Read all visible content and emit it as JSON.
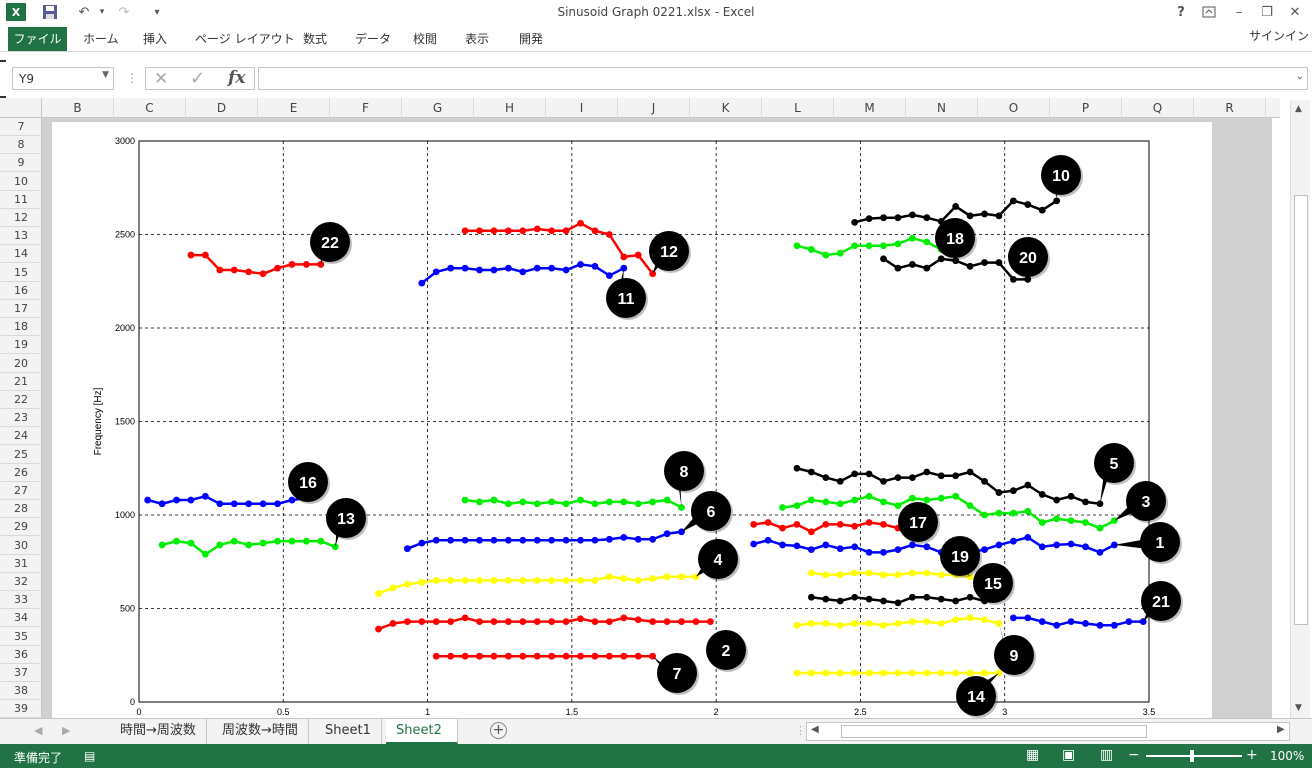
{
  "window": {
    "title": "Sinusoid Graph 0221.xlsx - Excel",
    "help": "?",
    "min": "–",
    "restore": "❐",
    "close": "✕"
  },
  "qat": {
    "undo": "↶",
    "redo": "↷",
    "more": "▾"
  },
  "ribbon": {
    "file": "ファイル",
    "tabs": [
      "ホーム",
      "挿入",
      "ページ レイアウト",
      "数式",
      "データ",
      "校閲",
      "表示",
      "開発"
    ],
    "signin": "サインイン"
  },
  "formula_bar": {
    "name_box": "Y9",
    "cancel": "✕",
    "enter": "✓",
    "fx": "fx",
    "value": ""
  },
  "columns": [
    "B",
    "C",
    "D",
    "E",
    "F",
    "G",
    "H",
    "I",
    "J",
    "K",
    "L",
    "M",
    "N",
    "O",
    "P",
    "Q",
    "R"
  ],
  "rows": [
    "7",
    "8",
    "9",
    "10",
    "11",
    "12",
    "13",
    "14",
    "15",
    "16",
    "17",
    "18",
    "19",
    "20",
    "21",
    "22",
    "23",
    "24",
    "25",
    "26",
    "27",
    "28",
    "29",
    "30",
    "31",
    "32",
    "33",
    "34",
    "35",
    "36",
    "37",
    "38",
    "39"
  ],
  "sheets": [
    "時間→周波数",
    "周波数→時間",
    "Sheet1",
    "Sheet2"
  ],
  "active_sheet": "Sheet2",
  "status": {
    "ready": "準備完了",
    "zoom": "100%"
  },
  "chart_data": {
    "type": "line",
    "ylabel": "Frequency [Hz]",
    "xlim": [
      0,
      3.5
    ],
    "ylim": [
      0,
      3000
    ],
    "xticks": [
      "0",
      "0.5",
      "1",
      "1.5",
      "2",
      "2.5",
      "3",
      "3.5"
    ],
    "yticks": [
      "0",
      "500",
      "1000",
      "1500",
      "2000",
      "2500",
      "3000"
    ],
    "grid": true,
    "series": [
      {
        "name": "1",
        "color": "#0000ff",
        "x": [
          2.13,
          2.18,
          2.23,
          2.28,
          2.33,
          2.38,
          2.43,
          2.48,
          2.53,
          2.58,
          2.63,
          2.68,
          2.73,
          2.78,
          2.83,
          2.88,
          2.93,
          2.98,
          3.03,
          3.08,
          3.13,
          3.18,
          3.23,
          3.28,
          3.33,
          3.38
        ],
        "y": [
          845,
          865,
          840,
          835,
          815,
          840,
          820,
          830,
          800,
          800,
          815,
          840,
          830,
          800,
          825,
          800,
          815,
          840,
          860,
          880,
          830,
          840,
          845,
          830,
          800,
          840
        ]
      },
      {
        "name": "2",
        "color": "#ff0000",
        "x": [
          0.83,
          0.88,
          0.93,
          0.98,
          1.03,
          1.08,
          1.13,
          1.18,
          1.23,
          1.28,
          1.33,
          1.38,
          1.43,
          1.48,
          1.53,
          1.58,
          1.63,
          1.68,
          1.73,
          1.78,
          1.83,
          1.88,
          1.93,
          1.98
        ],
        "y": [
          390,
          420,
          430,
          430,
          430,
          430,
          450,
          430,
          430,
          430,
          430,
          430,
          430,
          430,
          445,
          430,
          430,
          450,
          440,
          430,
          430,
          430,
          430,
          430
        ]
      },
      {
        "name": "3",
        "color": "#00ee00",
        "x": [
          2.23,
          2.28,
          2.33,
          2.38,
          2.43,
          2.48,
          2.53,
          2.58,
          2.63,
          2.68,
          2.73,
          2.78,
          2.83,
          2.88,
          2.93,
          2.98,
          3.03,
          3.08,
          3.13,
          3.18,
          3.23,
          3.28,
          3.33,
          3.38
        ],
        "y": [
          1040,
          1050,
          1080,
          1070,
          1060,
          1080,
          1100,
          1070,
          1050,
          1090,
          1080,
          1090,
          1100,
          1050,
          1000,
          1010,
          1010,
          1020,
          960,
          980,
          970,
          960,
          930,
          970
        ]
      },
      {
        "name": "4",
        "color": "#ffff00",
        "x": [
          0.83,
          0.88,
          0.93,
          0.98,
          1.03,
          1.08,
          1.13,
          1.18,
          1.23,
          1.28,
          1.33,
          1.38,
          1.43,
          1.48,
          1.53,
          1.58,
          1.63,
          1.68,
          1.73,
          1.78,
          1.83,
          1.88,
          1.93
        ],
        "y": [
          580,
          610,
          630,
          640,
          650,
          650,
          650,
          650,
          650,
          650,
          650,
          650,
          650,
          650,
          650,
          650,
          670,
          660,
          650,
          660,
          670,
          670,
          670
        ]
      },
      {
        "name": "5",
        "color": "#000000",
        "x": [
          2.28,
          2.33,
          2.38,
          2.43,
          2.48,
          2.53,
          2.58,
          2.63,
          2.68,
          2.73,
          2.78,
          2.83,
          2.88,
          2.93,
          2.98,
          3.03,
          3.08,
          3.13,
          3.18,
          3.23,
          3.28,
          3.33
        ],
        "y": [
          1250,
          1230,
          1200,
          1180,
          1220,
          1220,
          1180,
          1200,
          1200,
          1230,
          1210,
          1210,
          1230,
          1180,
          1120,
          1130,
          1160,
          1110,
          1080,
          1100,
          1070,
          1060
        ]
      },
      {
        "name": "6",
        "color": "#0000ff",
        "x": [
          0.93,
          0.98,
          1.03,
          1.08,
          1.13,
          1.18,
          1.23,
          1.28,
          1.33,
          1.38,
          1.43,
          1.48,
          1.53,
          1.58,
          1.63,
          1.68,
          1.73,
          1.78,
          1.83,
          1.88
        ],
        "y": [
          820,
          850,
          865,
          865,
          865,
          865,
          865,
          865,
          865,
          865,
          865,
          865,
          865,
          865,
          870,
          880,
          870,
          870,
          900,
          910
        ]
      },
      {
        "name": "7",
        "color": "#ff0000",
        "x": [
          1.03,
          1.08,
          1.13,
          1.18,
          1.23,
          1.28,
          1.33,
          1.38,
          1.43,
          1.48,
          1.53,
          1.58,
          1.63,
          1.68,
          1.73,
          1.78
        ],
        "y": [
          245,
          245,
          245,
          245,
          245,
          245,
          245,
          245,
          245,
          245,
          245,
          245,
          245,
          245,
          245,
          245
        ]
      },
      {
        "name": "8",
        "color": "#00ee00",
        "x": [
          1.13,
          1.18,
          1.23,
          1.28,
          1.33,
          1.38,
          1.43,
          1.48,
          1.53,
          1.58,
          1.63,
          1.68,
          1.73,
          1.78,
          1.83,
          1.88
        ],
        "y": [
          1080,
          1070,
          1080,
          1060,
          1070,
          1060,
          1070,
          1060,
          1080,
          1060,
          1070,
          1070,
          1060,
          1070,
          1080,
          1040
        ]
      },
      {
        "name": "9",
        "color": "#ffff00",
        "x": [
          2.28,
          2.33,
          2.38,
          2.43,
          2.48,
          2.53,
          2.58,
          2.63,
          2.68,
          2.73,
          2.78,
          2.83,
          2.88,
          2.93,
          2.98
        ],
        "y": [
          410,
          420,
          420,
          410,
          420,
          420,
          410,
          420,
          430,
          430,
          420,
          440,
          450,
          440,
          420
        ]
      },
      {
        "name": "10",
        "color": "#000000",
        "x": [
          2.48,
          2.53,
          2.58,
          2.63,
          2.68,
          2.73,
          2.78,
          2.83,
          2.88,
          2.93,
          2.98,
          3.03,
          3.08,
          3.13,
          3.18
        ],
        "y": [
          2565,
          2585,
          2590,
          2590,
          2605,
          2590,
          2570,
          2650,
          2600,
          2610,
          2600,
          2680,
          2660,
          2630,
          2680
        ]
      },
      {
        "name": "11",
        "color": "#0000ff",
        "x": [
          0.98,
          1.03,
          1.08,
          1.13,
          1.18,
          1.23,
          1.28,
          1.33,
          1.38,
          1.43,
          1.48,
          1.53,
          1.58,
          1.63,
          1.68
        ],
        "y": [
          2240,
          2300,
          2320,
          2320,
          2310,
          2310,
          2320,
          2300,
          2320,
          2320,
          2310,
          2340,
          2330,
          2280,
          2320
        ]
      },
      {
        "name": "12",
        "color": "#ff0000",
        "x": [
          1.13,
          1.18,
          1.23,
          1.28,
          1.33,
          1.38,
          1.43,
          1.48,
          1.53,
          1.58,
          1.63,
          1.68,
          1.73,
          1.78
        ],
        "y": [
          2520,
          2520,
          2520,
          2520,
          2520,
          2530,
          2520,
          2520,
          2560,
          2520,
          2500,
          2380,
          2390,
          2290
        ]
      },
      {
        "name": "13",
        "color": "#00ee00",
        "x": [
          0.08,
          0.13,
          0.18,
          0.23,
          0.28,
          0.33,
          0.38,
          0.43,
          0.48,
          0.53,
          0.58,
          0.63,
          0.68
        ],
        "y": [
          840,
          860,
          850,
          790,
          840,
          860,
          840,
          850,
          860,
          860,
          860,
          860,
          830
        ]
      },
      {
        "name": "14",
        "color": "#ffff00",
        "x": [
          2.28,
          2.33,
          2.38,
          2.43,
          2.48,
          2.53,
          2.58,
          2.63,
          2.68,
          2.73,
          2.78,
          2.83,
          2.88,
          2.93,
          2.98
        ],
        "y": [
          155,
          155,
          155,
          155,
          155,
          155,
          155,
          155,
          155,
          155,
          155,
          155,
          155,
          155,
          155
        ]
      },
      {
        "name": "15",
        "color": "#000000",
        "x": [
          2.33,
          2.38,
          2.43,
          2.48,
          2.53,
          2.58,
          2.63,
          2.68,
          2.73,
          2.78,
          2.83,
          2.88,
          2.93
        ],
        "y": [
          560,
          550,
          540,
          560,
          550,
          540,
          530,
          560,
          560,
          550,
          540,
          560,
          540
        ]
      },
      {
        "name": "16",
        "color": "#0000ff",
        "x": [
          0.03,
          0.08,
          0.13,
          0.18,
          0.23,
          0.28,
          0.33,
          0.38,
          0.43,
          0.48,
          0.53,
          0.58
        ],
        "y": [
          1080,
          1060,
          1080,
          1080,
          1100,
          1060,
          1060,
          1060,
          1060,
          1060,
          1080,
          1090
        ]
      },
      {
        "name": "17",
        "color": "#ff0000",
        "x": [
          2.13,
          2.18,
          2.23,
          2.28,
          2.33,
          2.38,
          2.43,
          2.48,
          2.53,
          2.58,
          2.63
        ],
        "y": [
          950,
          960,
          930,
          950,
          910,
          950,
          950,
          940,
          960,
          950,
          930
        ]
      },
      {
        "name": "18",
        "color": "#00ee00",
        "x": [
          2.28,
          2.33,
          2.38,
          2.43,
          2.48,
          2.53,
          2.58,
          2.63,
          2.68,
          2.73,
          2.78
        ],
        "y": [
          2440,
          2420,
          2390,
          2400,
          2440,
          2440,
          2440,
          2450,
          2480,
          2460,
          2420
        ]
      },
      {
        "name": "19",
        "color": "#ffff00",
        "x": [
          2.33,
          2.38,
          2.43,
          2.48,
          2.53,
          2.58,
          2.63,
          2.68,
          2.73,
          2.78,
          2.83,
          2.88
        ],
        "y": [
          690,
          680,
          680,
          690,
          690,
          680,
          680,
          690,
          690,
          680,
          680,
          670
        ]
      },
      {
        "name": "20",
        "color": "#000000",
        "x": [
          2.58,
          2.63,
          2.68,
          2.73,
          2.78,
          2.83,
          2.88,
          2.93,
          2.98,
          3.03,
          3.08
        ],
        "y": [
          2370,
          2320,
          2340,
          2320,
          2370,
          2360,
          2330,
          2350,
          2350,
          2260,
          2260
        ]
      },
      {
        "name": "21",
        "color": "#0000ff",
        "x": [
          3.03,
          3.08,
          3.13,
          3.18,
          3.23,
          3.28,
          3.33,
          3.38,
          3.43,
          3.48
        ],
        "y": [
          450,
          450,
          430,
          410,
          430,
          420,
          410,
          410,
          430,
          430
        ]
      },
      {
        "name": "22",
        "color": "#ff0000",
        "x": [
          0.18,
          0.23,
          0.28,
          0.33,
          0.38,
          0.43,
          0.48,
          0.53,
          0.58,
          0.63
        ],
        "y": [
          2390,
          2390,
          2310,
          2310,
          2300,
          2290,
          2320,
          2340,
          2340,
          2340
        ]
      }
    ]
  }
}
